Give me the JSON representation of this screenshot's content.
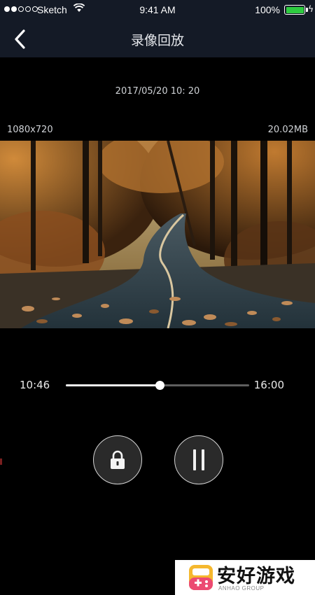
{
  "status_bar": {
    "carrier": "Sketch",
    "time": "9:41 AM",
    "battery": "100%",
    "battery_level": 1.0,
    "signal_bars": 2
  },
  "nav": {
    "back_icon": "chevron-left-icon",
    "title": "录像回放"
  },
  "recording": {
    "datetime": "2017/05/20 10: 20",
    "resolution": "1080x720",
    "file_size": "20.02MB"
  },
  "player": {
    "current_time": "10:46",
    "total_time": "16:00",
    "progress": 0.51
  },
  "controls": {
    "lock_icon": "lock-icon",
    "pause_icon": "pause-icon"
  },
  "watermark": {
    "title": "安好游戏",
    "subtitle": "ANHAO GROUP"
  },
  "colors": {
    "header_bg": "#141a26",
    "background": "#000000",
    "battery_green": "#2ecc40"
  }
}
